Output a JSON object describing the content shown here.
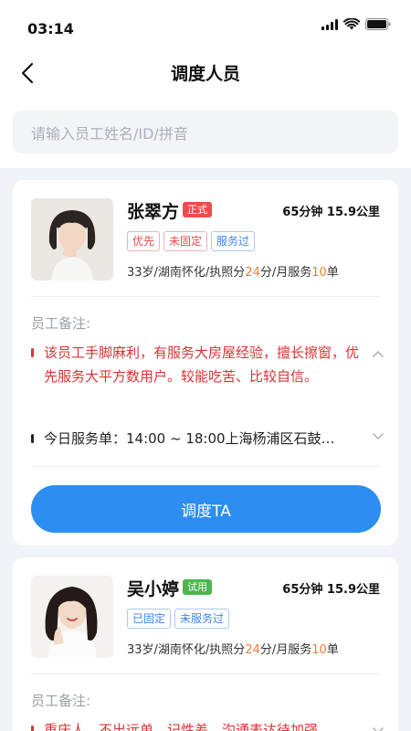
{
  "status_bar": {
    "time": "03:14"
  },
  "header": {
    "title": "调度人员"
  },
  "search": {
    "placeholder": "请输入员工姓名/ID/拼音"
  },
  "colors": {
    "primary": "#2b8ef0",
    "formal_badge": "#ef4b4b",
    "trial_badge": "#4cb54f",
    "highlight": "#f07c3a",
    "note_red": "#d93434"
  },
  "employees": [
    {
      "name": "张翠方",
      "status": "正式",
      "distance": "65分钟 15.9公里",
      "tags": [
        "优先",
        "未固定",
        "服务过"
      ],
      "info": {
        "prefix": "33岁/湖南怀化/执照分",
        "score": "24",
        "mid": "分/月服务",
        "count": "10",
        "suffix": "单"
      },
      "notes_label": "员工备注:",
      "note": "该员工手脚麻利，有服务大房屋经验，擅长擦窗，优先服务大平方数用户。较能吃苦、比较自信。",
      "today_order": "今日服务单：14:00 ~ 18:00上海杨浦区石鼓…",
      "action": "调度TA"
    },
    {
      "name": "吴小婷",
      "status": "试用",
      "distance": "65分钟 15.9公里",
      "tags": [
        "已固定",
        "未服务过"
      ],
      "info": {
        "prefix": "33岁/湖南怀化/执照分",
        "score": "24",
        "mid": "分/月服务",
        "count": "10",
        "suffix": "单"
      },
      "notes_label": "员工备注:",
      "note": "重庆人，不出远单，记性差，沟通表达待加强"
    }
  ]
}
